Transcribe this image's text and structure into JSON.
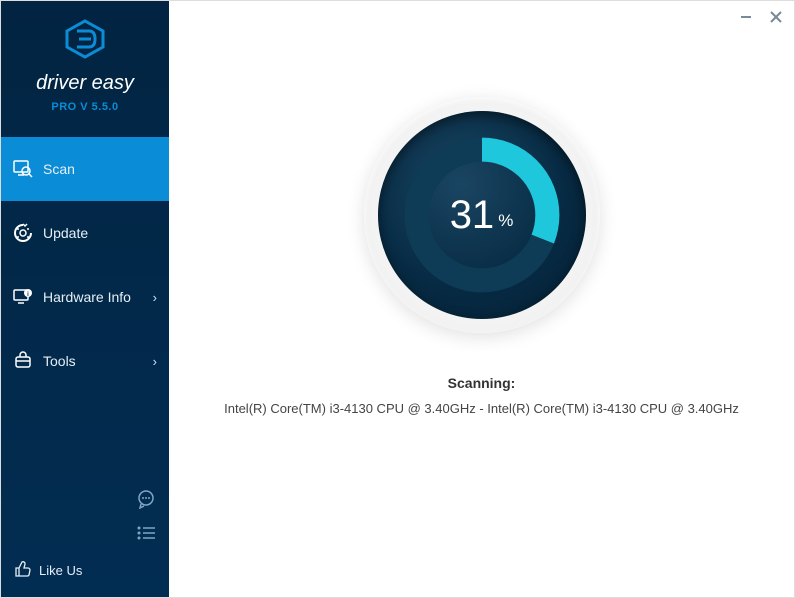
{
  "app": {
    "brand": "driver easy",
    "version": "PRO V 5.5.0"
  },
  "sidebar": {
    "items": [
      {
        "label": "Scan",
        "active": true,
        "expandable": false
      },
      {
        "label": "Update",
        "active": false,
        "expandable": false
      },
      {
        "label": "Hardware Info",
        "active": false,
        "expandable": true
      },
      {
        "label": "Tools",
        "active": false,
        "expandable": true
      }
    ],
    "like_label": "Like Us"
  },
  "scan": {
    "percent": 31,
    "percent_symbol": "%",
    "status_title": "Scanning:",
    "status_detail": "Intel(R) Core(TM) i3-4130 CPU @ 3.40GHz - Intel(R) Core(TM) i3-4130 CPU @ 3.40GHz"
  },
  "colors": {
    "accent": "#0a8dd6",
    "ring": "#1fc7dd",
    "sidebar_bg": "#022d52"
  }
}
